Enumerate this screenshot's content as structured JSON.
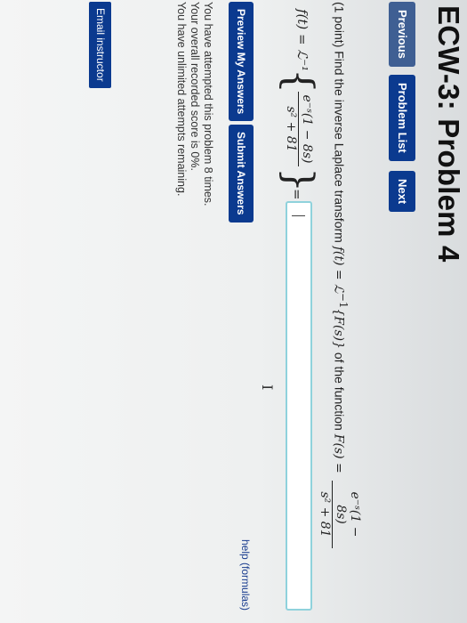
{
  "page": {
    "title": "ECW-3: Problem 4"
  },
  "nav": {
    "previous_label": "Previous",
    "problem_list_label": "Problem List",
    "next_label": "Next"
  },
  "problem": {
    "prefix": "(1 point) Find the inverse Laplace transform",
    "ft": "f(t)",
    "equals1": " = ",
    "laplace_inv": "ℒ",
    "sup_neg1": "−1",
    "Fs_braced": "{F(s)}",
    "mid_text": "of the function",
    "Fs": "F(s)",
    "equals2": " = ",
    "numerator": "e⁻ˢ(1 − 8s)",
    "denominator": "s² + 81"
  },
  "answer_row": {
    "lhs": "f(t) = ℒ⁻¹",
    "brace_open": "{",
    "brace_close": "}",
    "numerator": "e⁻ˢ(1 − 8s)",
    "denominator": "s² + 81",
    "equals": "=",
    "input_value": "",
    "cursor_glyph": "I"
  },
  "help": {
    "label": "help (formulas)"
  },
  "actions": {
    "preview_label": "Preview My Answers",
    "submit_label": "Submit Answers"
  },
  "status": {
    "attempted": "You have attempted this problem 8 times.",
    "score": "Your overall recorded score is 0%.",
    "remaining": "You have unlimited attempts remaining."
  },
  "email": {
    "label": "Email instructor"
  },
  "colors": {
    "button_bg": "#0b3a8f",
    "input_border": "#8fd2dc",
    "link": "#1a3d8f"
  }
}
